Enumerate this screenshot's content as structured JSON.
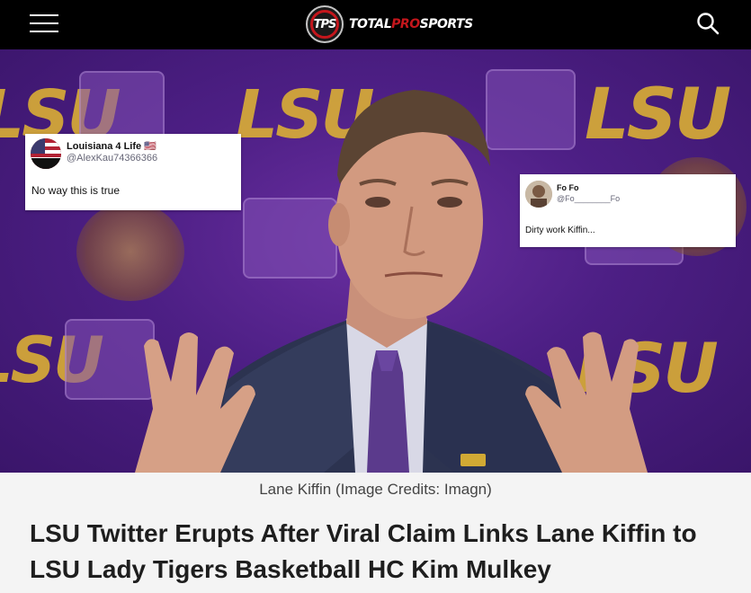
{
  "header": {
    "menu_icon": "hamburger-menu-icon",
    "logo_badge": "TPS",
    "logo_text_part1": "TOTAL",
    "logo_text_part2": "PRO",
    "logo_text_part3": "SPORTS",
    "search_icon": "search-icon"
  },
  "hero": {
    "background_color": "#4d1f85",
    "brand_gold": "#e3b731",
    "tweets": [
      {
        "name": "Louisiana 4 Life 🇺🇸",
        "handle": "@AlexKau74366366",
        "text": "No way this is true"
      },
      {
        "name": "Fo Fo",
        "handle": "@Fo________Fo",
        "text": "Dirty work Kiffin..."
      }
    ]
  },
  "article": {
    "caption": "Lane Kiffin (Image Credits: Imagn)",
    "title": "LSU Twitter Erupts After Viral Claim Links Lane Kiffin to LSU Lady Tigers Basketball HC Kim Mulkey"
  }
}
